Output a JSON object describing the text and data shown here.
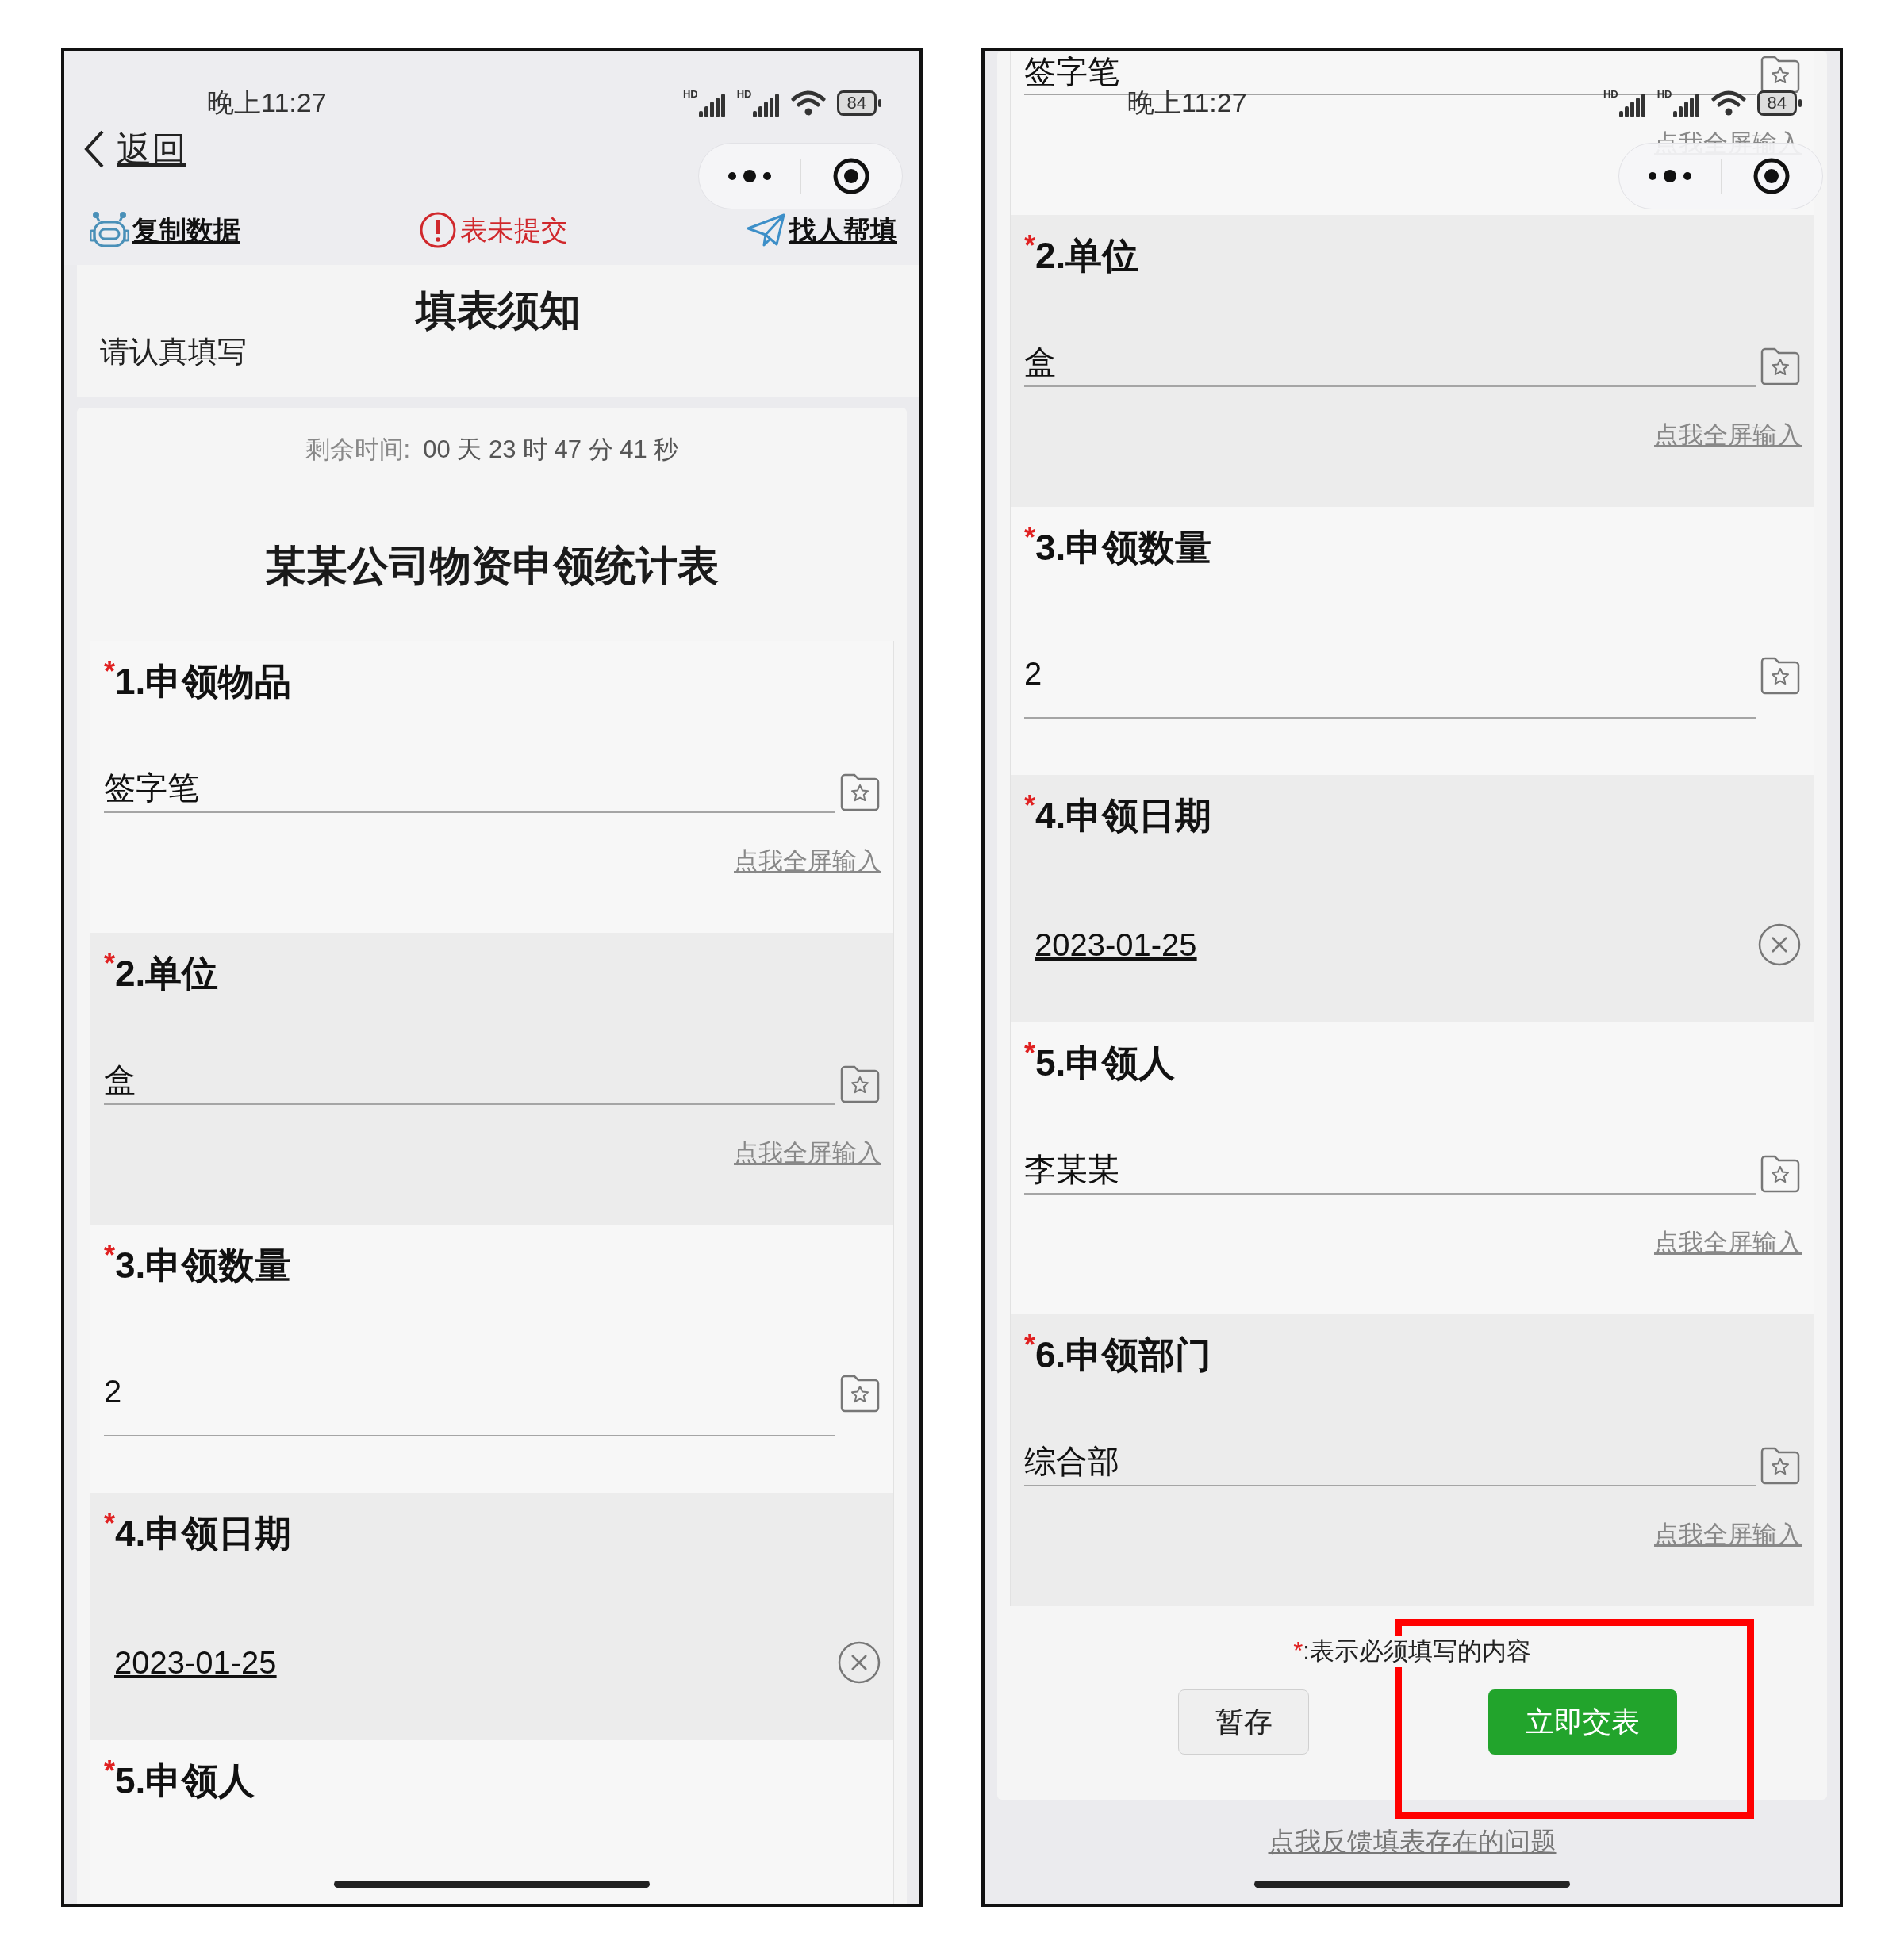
{
  "screens": [
    {
      "status_bar": {
        "time": "晚上11:27",
        "signals": [
          "HD",
          "HD"
        ],
        "battery": "84"
      },
      "nav": {
        "back": "返回"
      },
      "toolbar": {
        "copy": "复制数据",
        "status": "表未提交",
        "helper": "找人帮填"
      },
      "notice": {
        "title": "填表须知",
        "text": "请认真填写"
      },
      "countdown": {
        "label": "剩余时间:",
        "value": "00 天 23 时 47 分 41 秒"
      },
      "form_title": "某某公司物资申领统计表",
      "questions": [
        {
          "kind": "text",
          "mark": "*",
          "label": "1.申领物品",
          "value": "签字笔",
          "fullscreen_link": "点我全屏输入"
        },
        {
          "kind": "text",
          "mark": "*",
          "label": "2.单位",
          "value": "盒",
          "fullscreen_link": "点我全屏输入"
        },
        {
          "kind": "number",
          "mark": "*",
          "label": "3.申领数量",
          "value": "2"
        },
        {
          "kind": "date",
          "mark": "*",
          "label": "4.申领日期",
          "value": "2023-01-25"
        },
        {
          "kind": "heading",
          "mark": "*",
          "label": "5.申领人"
        }
      ]
    },
    {
      "status_bar": {
        "time": "晚上11:27",
        "signals": [
          "HD",
          "HD"
        ],
        "battery": "84"
      },
      "questions": [
        {
          "kind": "text",
          "value": "签字笔",
          "fullscreen_link": "点我全屏输入"
        },
        {
          "kind": "text",
          "mark": "*",
          "label": "2.单位",
          "value": "盒",
          "fullscreen_link": "点我全屏输入"
        },
        {
          "kind": "number",
          "mark": "*",
          "label": "3.申领数量",
          "value": "2"
        },
        {
          "kind": "date",
          "mark": "*",
          "label": "4.申领日期",
          "value": "2023-01-25"
        },
        {
          "kind": "text",
          "mark": "*",
          "label": "5.申领人",
          "value": "李某某",
          "fullscreen_link": "点我全屏输入"
        },
        {
          "kind": "text",
          "mark": "*",
          "label": "6.申领部门",
          "value": "综合部",
          "fullscreen_link": "点我全屏输入"
        }
      ],
      "footer": {
        "note_mark": "*",
        "note": ":表示必须填写的内容",
        "save": "暂存",
        "submit": "立即交表",
        "highlighted": true
      },
      "feedback_link": "点我反馈填表存在的问题"
    }
  ]
}
